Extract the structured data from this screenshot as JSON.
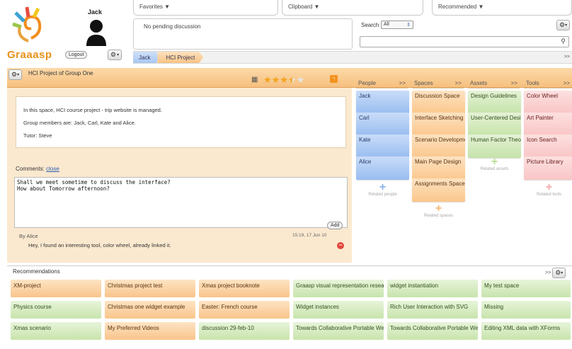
{
  "app": {
    "logo": "Graaasp"
  },
  "user": {
    "name": "Jack",
    "logout_label": "Logout"
  },
  "topbar": {
    "favorites": "Favorites ▼",
    "clipboard": "Clipboard ▼",
    "recommended": "Recommended ▼",
    "discussion": "No pending discussion",
    "search_label": "Search",
    "search_scope": "All"
  },
  "breadcrumb": [
    "Jack",
    "HCI Project"
  ],
  "space": {
    "title": "HCI Project of Group One",
    "rating": 3.5,
    "description": [
      "In this space, HCI course project - trip website is managed.",
      "Group members are: Jack, Carl, Kate and Alice.",
      "Tutor: Steve"
    ],
    "comments_label": "Comments:",
    "close_link": "close",
    "draft": "Shall we meet sometime to discuss the interface?\nHow about Tomorrow afternoon?",
    "add_label": "Add",
    "comment": {
      "author": "By Alice",
      "time": "15:19, 17 Jun 10",
      "text": "Hey, I found an interesting tool, color wheel, already linked it."
    }
  },
  "columns": {
    "people": {
      "label": "People",
      "more": ">>",
      "items": [
        "Jack",
        "Carl",
        "Kate",
        "Alice"
      ],
      "related": "Related people"
    },
    "spaces": {
      "label": "Spaces",
      "more": ">>",
      "items": [
        "Discussion Space",
        "Interface Sketching",
        "Scenario Development",
        "Main Page Design",
        "Assignments Space"
      ],
      "related": "Related spaces"
    },
    "assets": {
      "label": "Assets",
      "more": ">>",
      "items": [
        "Design Guidelines",
        "User-Centered Design",
        "Human Factor Theory"
      ],
      "related": "Related assets"
    },
    "tools": {
      "label": "Tools",
      "more": ">>",
      "items": [
        "Color Wheel",
        "Art Painter",
        "Icon Search",
        "Picture Library"
      ],
      "related": "Related tools"
    }
  },
  "recommendations": {
    "title": "Recommendations",
    "more": ">>",
    "rows": [
      [
        "XM-project",
        "Christmas project test",
        "Xmas project booknote",
        "Graasp visual representation research",
        "widget instantiation",
        "My test space"
      ],
      [
        "Physics course",
        "Christmas one widget example",
        "Easter: French course",
        "Widget instances",
        "Rich User Interaction with SVG",
        "Missing"
      ],
      [
        "Xmas scenario",
        "My Preferred Videos",
        "discussion 29-feb-10",
        "Towards Collaborative Portable Web Spaces",
        "Towards Collaborative Portable Web Spaces",
        "Editing XML data with XForms"
      ]
    ]
  },
  "colors": {
    "accent": "#f6c07e",
    "people": "#98bdf0",
    "spaces": "#fbc78c",
    "assets": "#c6e3aa",
    "tools": "#f9c5c5",
    "remove": "#e0483c"
  }
}
